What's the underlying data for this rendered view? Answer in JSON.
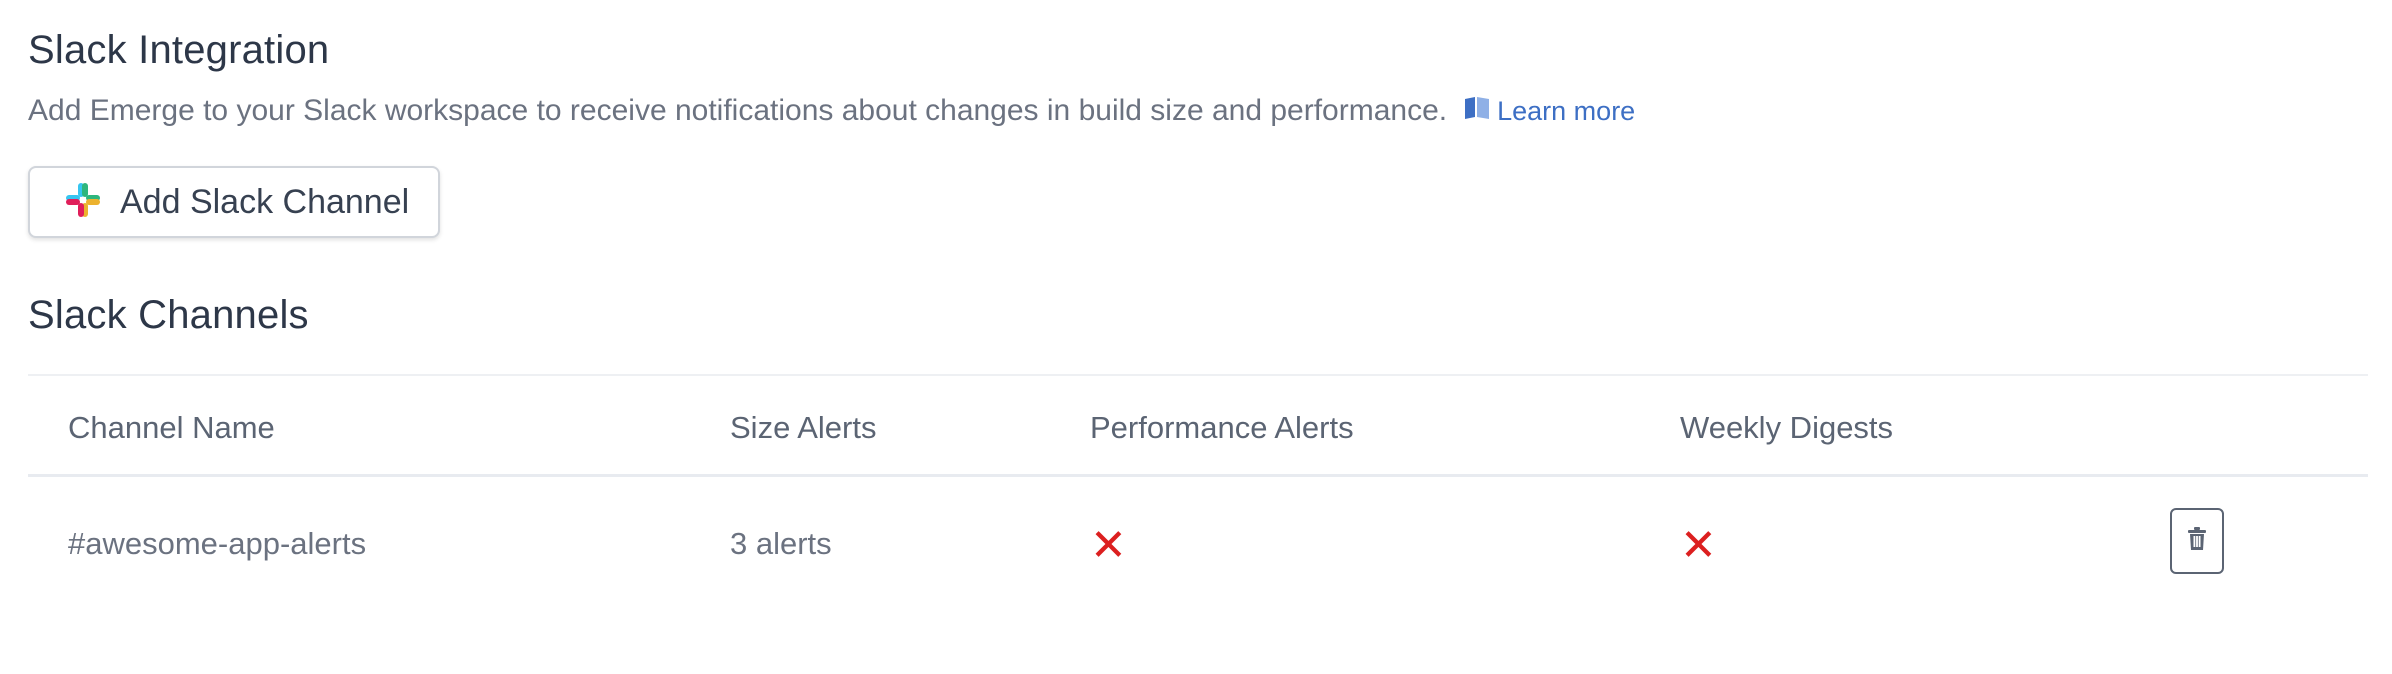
{
  "integration": {
    "title": "Slack Integration",
    "description": "Add Emerge to your Slack workspace to receive notifications about changes in build size and performance.",
    "learn_more_label": "Learn more",
    "learn_more_icon": "book-icon",
    "accent_color": "#3d6fc4"
  },
  "add_channel_button": {
    "label": "Add Slack Channel",
    "icon": "slack-logo-icon"
  },
  "channels": {
    "title": "Slack Channels",
    "columns": [
      "Channel Name",
      "Size Alerts",
      "Performance Alerts",
      "Weekly Digests"
    ],
    "rows": [
      {
        "channel_name": "#awesome-app-alerts",
        "size_alerts": "3 alerts",
        "performance_alerts": "✕",
        "weekly_digests": "✕",
        "delete_icon": "trash-icon"
      }
    ],
    "disabled_color": "#dc1f1f"
  }
}
